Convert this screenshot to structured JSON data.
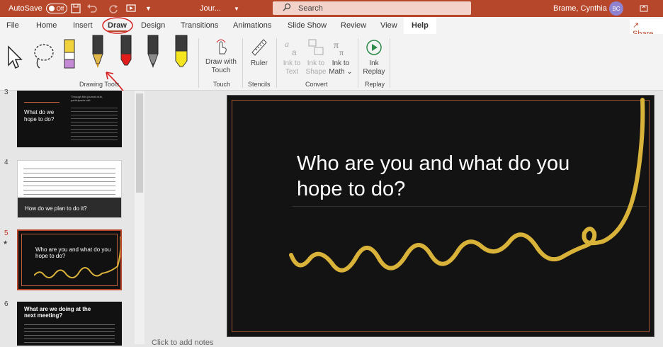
{
  "titlebar": {
    "autosave_label": "AutoSave",
    "autosave_state": "Off",
    "doc_title": "Jour...",
    "search_placeholder": "Search",
    "user_name": "Brame, Cynthia J",
    "user_initials": "BC"
  },
  "tabs": [
    "File",
    "Home",
    "Insert",
    "Draw",
    "Design",
    "Transitions",
    "Animations",
    "Slide Show",
    "Review",
    "View",
    "Help"
  ],
  "share_label": "Share",
  "ribbon": {
    "draw_with_touch": [
      "Draw with",
      "Touch"
    ],
    "ruler": "Ruler",
    "ink_to_text": [
      "Ink to",
      "Text"
    ],
    "ink_to_shape": [
      "Ink to",
      "Shape"
    ],
    "ink_to_math": [
      "Ink to",
      "Math ⌄"
    ],
    "ink_replay": [
      "Ink",
      "Replay"
    ],
    "groups": {
      "drawing_tools": "Drawing Tools",
      "touch": "Touch",
      "stencils": "Stencils",
      "convert": "Convert",
      "replay": "Replay"
    }
  },
  "thumbnails": [
    {
      "number": "3",
      "title": "What do we hope to do?",
      "body": "Through this journal club, participants will:"
    },
    {
      "number": "4",
      "title": "How do we plan to do it?"
    },
    {
      "number": "5",
      "title": "Who are you and what do you hope to do?"
    },
    {
      "number": "6",
      "title": "What are we doing at the next meeting?"
    }
  ],
  "slide": {
    "title": "Who are you and what do you hope to do?"
  },
  "notes_placeholder": "Click to add notes",
  "colors": {
    "brand": "#b7472a",
    "squiggle": "#d9b23a"
  }
}
